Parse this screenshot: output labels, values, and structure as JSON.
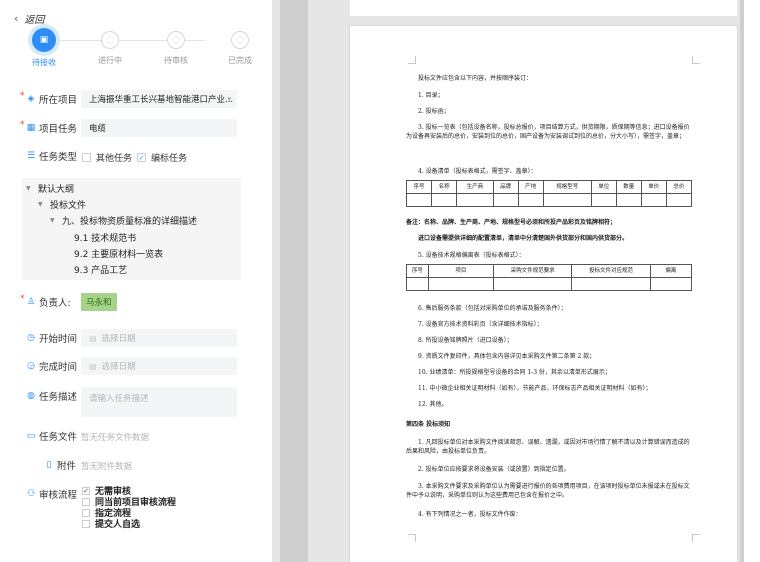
{
  "back_label": "返回",
  "steps": [
    {
      "label": "待接收",
      "active": true
    },
    {
      "label": "进行中",
      "active": false
    },
    {
      "label": "待审核",
      "active": false
    },
    {
      "label": "已完成",
      "active": false
    }
  ],
  "form": {
    "project": {
      "label": "所在项目",
      "value": "上海振华重工长兴基地智能港口产业..."
    },
    "task": {
      "label": "项目任务",
      "value": "电缆"
    },
    "task_type": {
      "label": "任务类型",
      "options": [
        "其他任务",
        "编标任务"
      ],
      "selected": "编标任务"
    },
    "tree": {
      "root": "默认大纲",
      "child": "投标文件",
      "section": "九、投标物资质量标准的详细描述",
      "items": [
        "9.1 技术规范书",
        "9.2 主要原材料一览表",
        "9.3 产品工艺"
      ]
    },
    "owner": {
      "label": "负责人:",
      "value": "马永和"
    },
    "start_time": {
      "label": "开始时间",
      "placeholder": "选择日期"
    },
    "end_time": {
      "label": "完成时间",
      "placeholder": "选择日期"
    },
    "description": {
      "label": "任务描述",
      "placeholder": "请输入任务描述"
    },
    "task_files": {
      "label": "任务文件",
      "value": "暂无任务文件数据"
    },
    "attachments": {
      "label": "附件",
      "value": "暂无附件数据"
    },
    "review": {
      "label": "审核流程",
      "options": [
        "无需审核",
        "同当前项目审核流程",
        "指定流程",
        "提交人自选"
      ],
      "checked": "无需审核"
    }
  },
  "document": {
    "intro": "投标文件应包含以下内容，并按顺序装订：",
    "items": [
      "1. 目录；",
      "2. 投标函；",
      "3. 投标一览表（包括设备名称，投标总报价，项目结算方式，供货期限，质保期等信息；进口设备报价为设备再安装后的总价，安装到位的总价，国产设备为安装调试到位的总价，分大小写），需签字，盖章；",
      "4. 设备清单（投标表格式，需签字、盖章）："
    ],
    "table1_headers": [
      "序号",
      "名称",
      "生产商",
      "品牌",
      "产地",
      "规格型号",
      "单位",
      "数量",
      "单价",
      "总价"
    ],
    "note1": "备注：名称、品牌、生产商、产地、规格型号必须和所投产品彩页及铭牌相符；",
    "note2": "进口设备需提供详细的配置清单，清单中分清楚国外供货部分和国内供货部分。",
    "item5": "5. 设备技术规格偏离表（投标表格式）：",
    "table2_headers": [
      "序号",
      "项目",
      "采购文件规范要求",
      "投标文件对应规范",
      "偏离"
    ],
    "items_after": [
      "6. 售后服务条款（包括对采购单位的承诺及服务条件）；",
      "7. 设备官方技术资料彩页（含详细技术指标）；",
      "8. 所投设备铭牌照片（进口设备）；",
      "9. 资质文件复印件，具体包含内容详见本采购文件第二条第 2 款；",
      "10. 业绩清单：所投规格型号设备的合同 1-3 份，其余以清单形式展示；",
      "11. 中小微企业相关证明材料（如有），节能产品，环保标志产品相关证明材料（如有）；",
      "12. 其他。"
    ],
    "section4_title": "第四条  投标须知",
    "section4_items": [
      "1. 凡回投标单位对本采购文件阅读疏忽、误解、遗漏，或因对市场行情了解不清以及计算错误而造成的后果和风险，由投标单位负责。",
      "2. 投标单位应按要求将设备安装（或放置）到指定位置。",
      "3. 本采购文件要求及采购单位认为需要进行报价的各项费用项目，在该项时投标单位未报或未在投标文件中予以说明，采购单位则认为这些费用已包含在报价之中。",
      "4. 有下列情况之一者，投标文件作废："
    ]
  }
}
